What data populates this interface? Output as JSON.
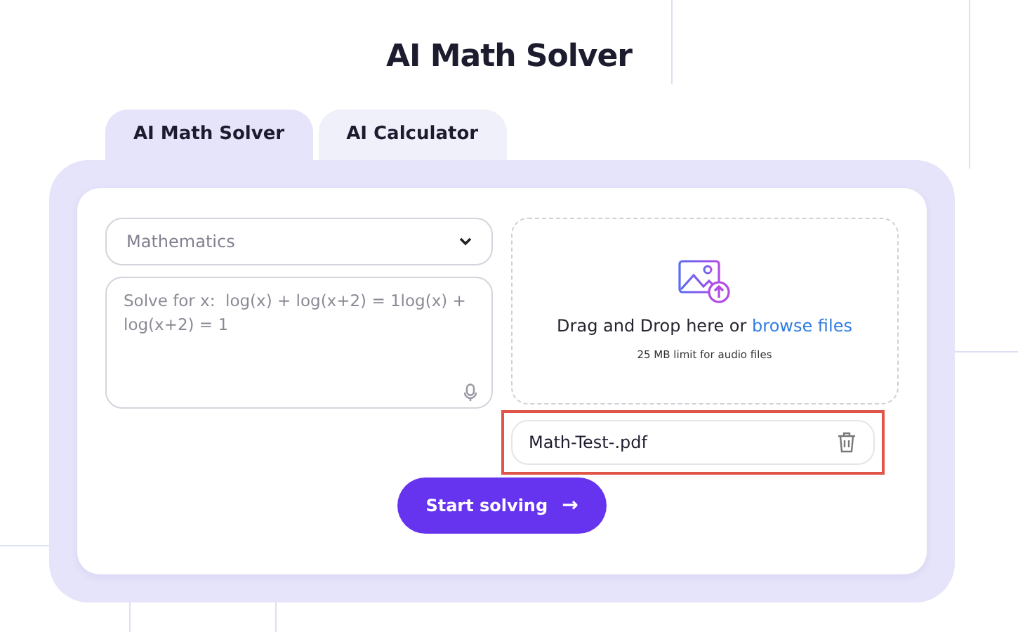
{
  "title": "AI Math Solver",
  "tabs": [
    {
      "label": "AI Math Solver",
      "selected": true
    },
    {
      "label": "AI Calculator",
      "selected": false
    }
  ],
  "subject_select": {
    "value": "Mathematics"
  },
  "question_field": {
    "placeholder": "Solve for x:  log(x) + log(x+2) = 1log(x) + log(x+2) = 1"
  },
  "upload": {
    "prompt": "Drag and Drop here or ",
    "link": "browse files",
    "limit": "25 MB limit for audio files"
  },
  "files": [
    {
      "name": "Math-Test-.pdf",
      "highlighted": true
    }
  ],
  "submit_button": {
    "label": "Start solving",
    "arrow": "→"
  }
}
